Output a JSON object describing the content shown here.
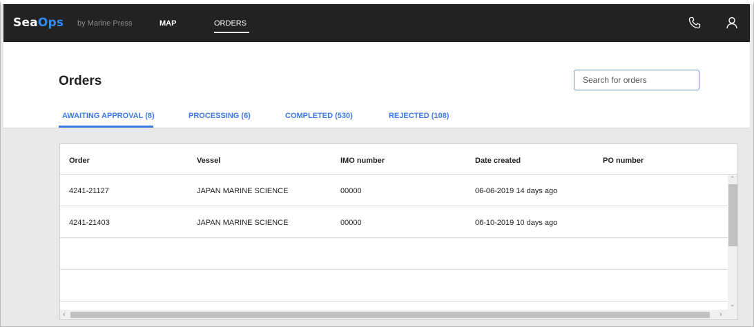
{
  "app": {
    "brand_primary": "Sea",
    "brand_accent": "Ops",
    "brand_sub": "by Marine Press",
    "nav": [
      {
        "label": "MAP"
      },
      {
        "label": "ORDERS",
        "active": true
      }
    ],
    "icons": [
      "phone-icon",
      "user-icon"
    ]
  },
  "page": {
    "title": "Orders",
    "search_placeholder": "Search for orders",
    "tabs": [
      {
        "label": "AWAITING APPROVAL (8)",
        "active": true
      },
      {
        "label": "PROCESSING (6)"
      },
      {
        "label": "COMPLETED (530)"
      },
      {
        "label": "REJECTED (108)"
      }
    ]
  },
  "table": {
    "columns": [
      "Order",
      "Vessel",
      "IMO number",
      "Date created",
      "PO number"
    ],
    "rows": [
      [
        "4241-21127",
        "JAPAN MARINE SCIENCE",
        "00000",
        "06-06-2019 14 days ago",
        ""
      ],
      [
        "4241-21403",
        "JAPAN MARINE SCIENCE",
        "00000",
        "06-10-2019 10 days ago",
        ""
      ],
      [
        "",
        "",
        "",
        "",
        ""
      ],
      [
        "",
        "",
        "",
        "",
        ""
      ]
    ]
  },
  "colors": {
    "topbar": "#222222",
    "brand_accent": "#2f8cf0",
    "tab_blue": "#3b78e7",
    "background": "#e9e9e9"
  }
}
